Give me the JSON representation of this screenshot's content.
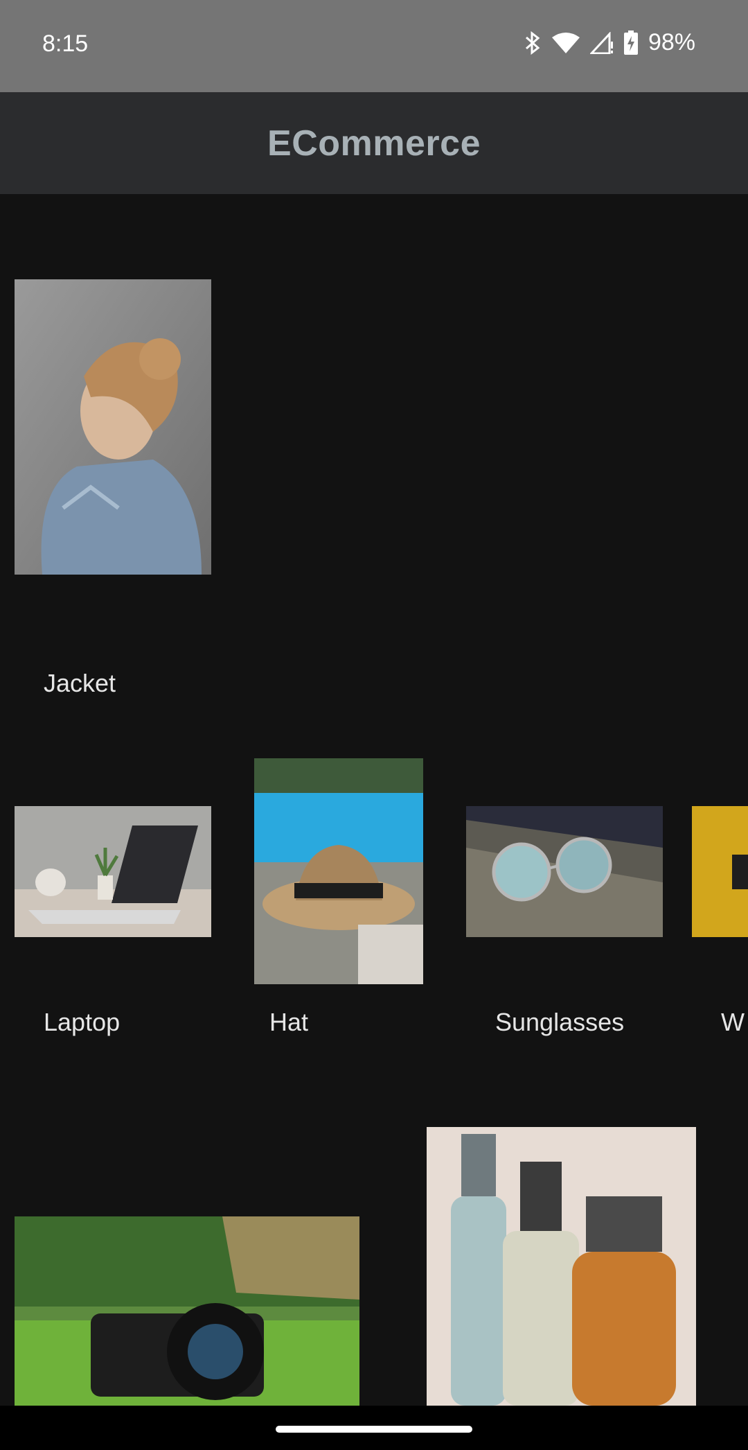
{
  "status_bar": {
    "time": "8:15",
    "battery_text": "98%",
    "icons": [
      "bluetooth-icon",
      "wifi-icon",
      "cell-signal-icon",
      "battery-charging-icon"
    ]
  },
  "app_bar": {
    "title": "ECommerce"
  },
  "products": [
    {
      "label": "Jacket",
      "image": "woman-in-denim-jacket"
    },
    {
      "label": "Laptop",
      "image": "laptop-on-desk"
    },
    {
      "label": "Hat",
      "image": "straw-hat-by-pool"
    },
    {
      "label": "Sunglasses",
      "image": "round-sunglasses"
    },
    {
      "label": "W",
      "image": "yellow-watch-partial"
    },
    {
      "label": "",
      "image": "camera-on-grass"
    },
    {
      "label": "",
      "image": "perfume-bottles"
    }
  ],
  "colors": {
    "status_bar_bg": "#757575",
    "app_bar_bg": "#2b2c2e",
    "title_color": "#a8b1b6",
    "background": "#121212"
  }
}
